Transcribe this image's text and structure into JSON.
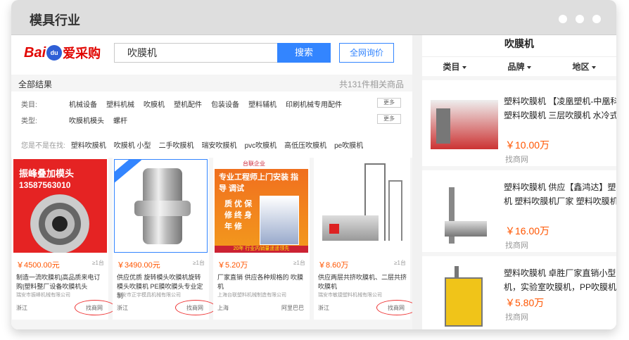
{
  "window": {
    "title": "模具行业"
  },
  "search": {
    "logo_bai": "Bai",
    "logo_du": "du",
    "logo_aicai": "爱采购",
    "query": "吹膜机",
    "search_label": "搜索",
    "allnet_label": "全网询价"
  },
  "results": {
    "all_label": "全部结果",
    "count_text": "共131件相关商品"
  },
  "filters": [
    {
      "label": "类目:",
      "options": [
        "机械设备",
        "塑料机械",
        "吹膜机",
        "塑机配件",
        "包装设备",
        "塑料辅机",
        "印刷机械专用配件"
      ],
      "more": "更多"
    },
    {
      "label": "类型:",
      "options": [
        "吹膜机模头",
        "螺杆"
      ],
      "more": "更多"
    }
  ],
  "suggest": {
    "label": "您是不是在找:",
    "options": [
      "塑料吹膜机",
      "吹膜机 小型",
      "二手吹膜机",
      "瑞安吹膜机",
      "pvc吹膜机",
      "高低压吹膜机",
      "pe吹膜机"
    ]
  },
  "cards": [
    {
      "price": "￥4500.00元",
      "moq": "≥1台",
      "desc": "制造一流吹膜机|高品质来电订购|塑料整厂设备吹膜机头",
      "company": "瑞安市振峰机械有限公司",
      "region": "浙江",
      "source": "找商网",
      "img_text1": "振峰叠加模头",
      "img_text2": "13587563010"
    },
    {
      "price": "￥3490.00元",
      "moq": "≥1台",
      "desc": "供应优质 旋转模头吹膜机旋转模头吹膜机 PE膜吹膜头专业定制",
      "company": "瑞安市正宇模具机械有限公司",
      "region": "浙江",
      "source": "找商网"
    },
    {
      "price": "￥5.20万",
      "moq": "≥1台",
      "desc": "厂家直销 供应各种规格的 吹膜机",
      "company": "上海台联塑料机械制造有限公司",
      "region": "上海",
      "source": "阿里巴巴",
      "img_head": "台联企业",
      "img_band": "专业工程师上门安装 指导 调试",
      "img_vtext": "质 优 保 修 终 身 年 修",
      "img_foot": "20年 行业内销量遥遥领先"
    },
    {
      "price": "￥8.60万",
      "moq": "≥1台",
      "desc": "供应两层共挤吹膜机、二层共挤吹膜机",
      "company": "瑞安市敏捷塑料机械有限公司",
      "region": "浙江",
      "source": "找商网"
    }
  ],
  "right_panel": {
    "title": "吹膜机",
    "tabs": [
      "类目",
      "品牌",
      "地区"
    ],
    "items": [
      {
        "text": "塑料吹膜机 【凌凰塑机-中凰科层塑料吹膜机 三层吹膜机 水冷式",
        "price": "￥10.00万",
        "source": "找商网"
      },
      {
        "text": "塑料吹膜机 供应【鑫鸿达】塑料机 塑料吹膜机厂家 塑料吹膜机",
        "price": "￥16.00万",
        "source": "找商网"
      },
      {
        "text": "塑料吹膜机 卓胜厂家直销小型吹机，实验室吹膜机，PP吹膜机",
        "price": "￥5.80万",
        "source": "找商网"
      }
    ]
  }
}
